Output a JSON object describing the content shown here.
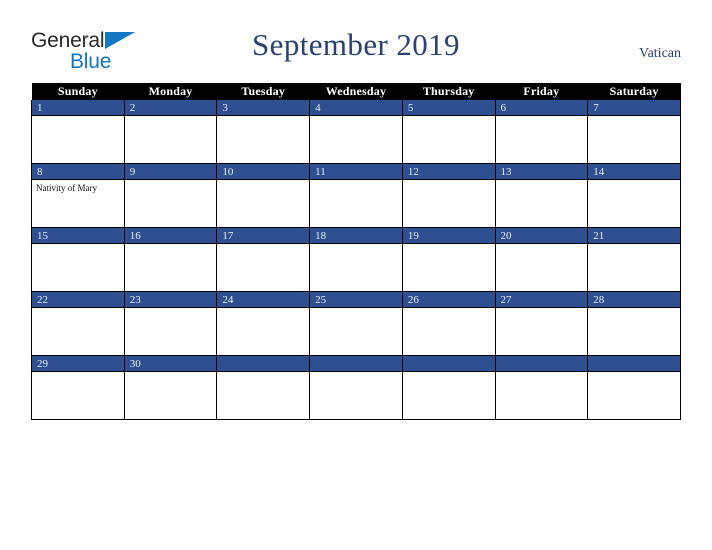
{
  "brand": {
    "name_part1": "General",
    "name_part2": "Blue",
    "triangle_color": "#1477c4",
    "text_color": "#2b2b2b"
  },
  "header": {
    "title": "September 2019",
    "locale": "Vatican",
    "title_color": "#2b4270"
  },
  "calendar": {
    "month": "September",
    "year": "2019",
    "weekday_headers": [
      "Sunday",
      "Monday",
      "Tuesday",
      "Wednesday",
      "Thursday",
      "Friday",
      "Saturday"
    ],
    "header_bg": "#000000",
    "daybar_bg": "#2e5090",
    "daybar_text": "#e8ecf5",
    "cell_bg": "#fdfdfd",
    "weeks": [
      [
        {
          "date": "1",
          "events": []
        },
        {
          "date": "2",
          "events": []
        },
        {
          "date": "3",
          "events": []
        },
        {
          "date": "4",
          "events": []
        },
        {
          "date": "5",
          "events": []
        },
        {
          "date": "6",
          "events": []
        },
        {
          "date": "7",
          "events": []
        }
      ],
      [
        {
          "date": "8",
          "events": [
            "Nativity of Mary"
          ]
        },
        {
          "date": "9",
          "events": []
        },
        {
          "date": "10",
          "events": []
        },
        {
          "date": "11",
          "events": []
        },
        {
          "date": "12",
          "events": []
        },
        {
          "date": "13",
          "events": []
        },
        {
          "date": "14",
          "events": []
        }
      ],
      [
        {
          "date": "15",
          "events": []
        },
        {
          "date": "16",
          "events": []
        },
        {
          "date": "17",
          "events": []
        },
        {
          "date": "18",
          "events": []
        },
        {
          "date": "19",
          "events": []
        },
        {
          "date": "20",
          "events": []
        },
        {
          "date": "21",
          "events": []
        }
      ],
      [
        {
          "date": "22",
          "events": []
        },
        {
          "date": "23",
          "events": []
        },
        {
          "date": "24",
          "events": []
        },
        {
          "date": "25",
          "events": []
        },
        {
          "date": "26",
          "events": []
        },
        {
          "date": "27",
          "events": []
        },
        {
          "date": "28",
          "events": []
        }
      ],
      [
        {
          "date": "29",
          "events": []
        },
        {
          "date": "30",
          "events": []
        },
        {
          "date": "",
          "events": []
        },
        {
          "date": "",
          "events": []
        },
        {
          "date": "",
          "events": []
        },
        {
          "date": "",
          "events": []
        },
        {
          "date": "",
          "events": []
        }
      ]
    ]
  }
}
